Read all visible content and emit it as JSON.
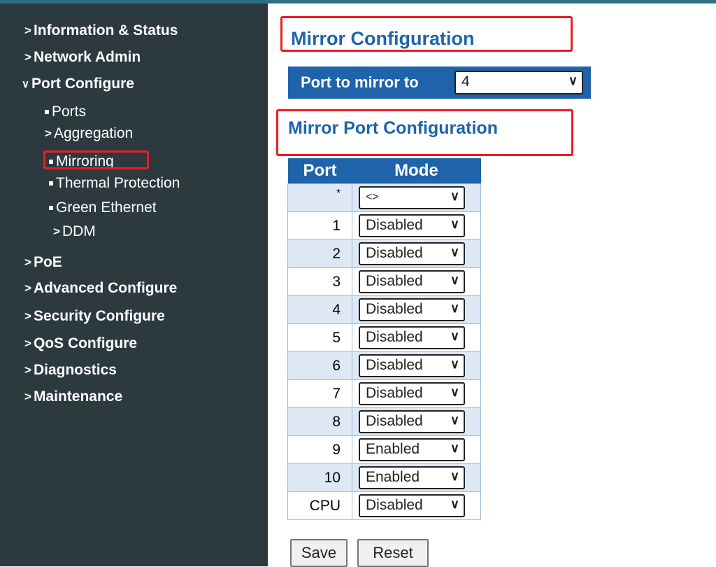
{
  "nav": {
    "information_status": "Information & Status",
    "network_admin": "Network Admin",
    "port_configure": "Port Configure",
    "port_sub": {
      "ports": "Ports",
      "aggregation": "Aggregation",
      "mirroring": "Mirroring",
      "thermal": "Thermal Protection",
      "green": "Green Ethernet",
      "ddm": "DDM"
    },
    "poe": "PoE",
    "advanced": "Advanced Configure",
    "security": "Security Configure",
    "qos": "QoS Configure",
    "diagnostics": "Diagnostics",
    "maintenance": "Maintenance"
  },
  "page_title": "Mirror Configuration",
  "port_to_mirror": {
    "label": "Port to mirror to",
    "value": "4"
  },
  "section_title": "Mirror Port Configuration",
  "table": {
    "headers": [
      "Port",
      "Mode"
    ],
    "rows": [
      {
        "port": "*",
        "mode": "<>"
      },
      {
        "port": "1",
        "mode": "Disabled"
      },
      {
        "port": "2",
        "mode": "Disabled"
      },
      {
        "port": "3",
        "mode": "Disabled"
      },
      {
        "port": "4",
        "mode": "Disabled"
      },
      {
        "port": "5",
        "mode": "Disabled"
      },
      {
        "port": "6",
        "mode": "Disabled"
      },
      {
        "port": "7",
        "mode": "Disabled"
      },
      {
        "port": "8",
        "mode": "Disabled"
      },
      {
        "port": "9",
        "mode": "Enabled"
      },
      {
        "port": "10",
        "mode": "Enabled"
      },
      {
        "port": "CPU",
        "mode": "Disabled"
      }
    ]
  },
  "buttons": {
    "save": "Save",
    "reset": "Reset"
  },
  "colors": {
    "sidebar_bg": "#2c3a40",
    "accent_blue": "#1f63ab",
    "highlight_red": "#ee1c24",
    "row_alt": "#dde8f4"
  }
}
